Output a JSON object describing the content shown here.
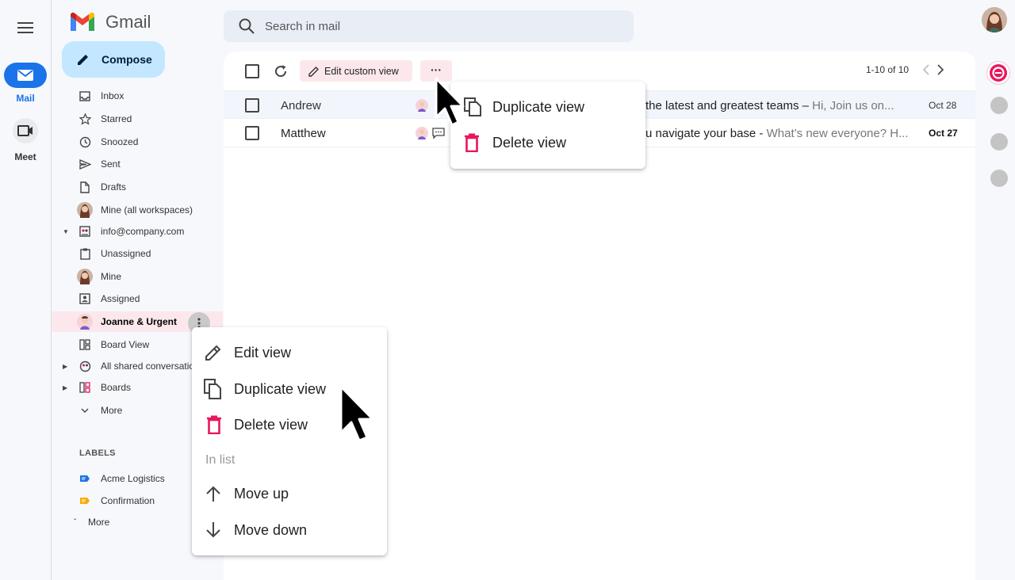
{
  "app": {
    "name": "Gmail"
  },
  "rail": {
    "mail_label": "Mail",
    "meet_label": "Meet"
  },
  "compose": {
    "label": "Compose"
  },
  "search": {
    "placeholder": "Search in mail"
  },
  "sidebar": {
    "items": [
      {
        "label": "Inbox",
        "icon": "inbox-icon"
      },
      {
        "label": "Starred",
        "icon": "star-icon"
      },
      {
        "label": "Snoozed",
        "icon": "clock-icon"
      },
      {
        "label": "Sent",
        "icon": "send-icon"
      },
      {
        "label": "Drafts",
        "icon": "draft-icon"
      },
      {
        "label": "Mine (all workspaces)",
        "icon": "avatar-icon"
      },
      {
        "label": "info@company.com",
        "icon": "shared-inbox-icon"
      },
      {
        "label": "Unassigned",
        "icon": "clipboard-icon"
      },
      {
        "label": "Mine",
        "icon": "avatar-icon"
      },
      {
        "label": "Assigned",
        "icon": "assigned-icon"
      },
      {
        "label": "Joanne & Urgent",
        "icon": "avatar-icon"
      },
      {
        "label": "Board View",
        "icon": "board-icon"
      },
      {
        "label": "All shared conversations",
        "icon": "shared-icon"
      },
      {
        "label": "Boards",
        "icon": "boards-icon"
      },
      {
        "label": "More",
        "icon": "chevron-down-icon"
      }
    ],
    "labels_heading": "LABELS",
    "labels": [
      {
        "label": "Acme Logistics",
        "color": "#1a73e8"
      },
      {
        "label": "Confirmation",
        "color": "#f9ab00"
      }
    ],
    "labels_more": "More"
  },
  "toolbar": {
    "edit_custom_view": "Edit custom view",
    "more": "···",
    "pagination": "1-10 of 10"
  },
  "emails": [
    {
      "sender": "Andrew",
      "subject": "the latest and greatest teams –",
      "snippet": " Hi, Join us on...",
      "date": "Oct 28",
      "unread": false
    },
    {
      "sender": "Matthew",
      "subject": "u navigate your base -",
      "snippet": " What’s new everyone? H...",
      "date": "Oct 27",
      "unread": true
    }
  ],
  "toolbar_menu": {
    "items": [
      {
        "label": "Duplicate view"
      },
      {
        "label": "Delete view"
      }
    ]
  },
  "context_menu": {
    "items": [
      {
        "label": "Edit view"
      },
      {
        "label": "Duplicate view"
      },
      {
        "label": "Delete view"
      }
    ],
    "section": "In list",
    "move_items": [
      {
        "label": "Move up"
      },
      {
        "label": "Move down"
      }
    ]
  },
  "colors": {
    "accent": "#c2e7ff",
    "brand_red": "#e8175d",
    "active_row": "#fce8ec",
    "selected_pill": "#1a73e8"
  }
}
